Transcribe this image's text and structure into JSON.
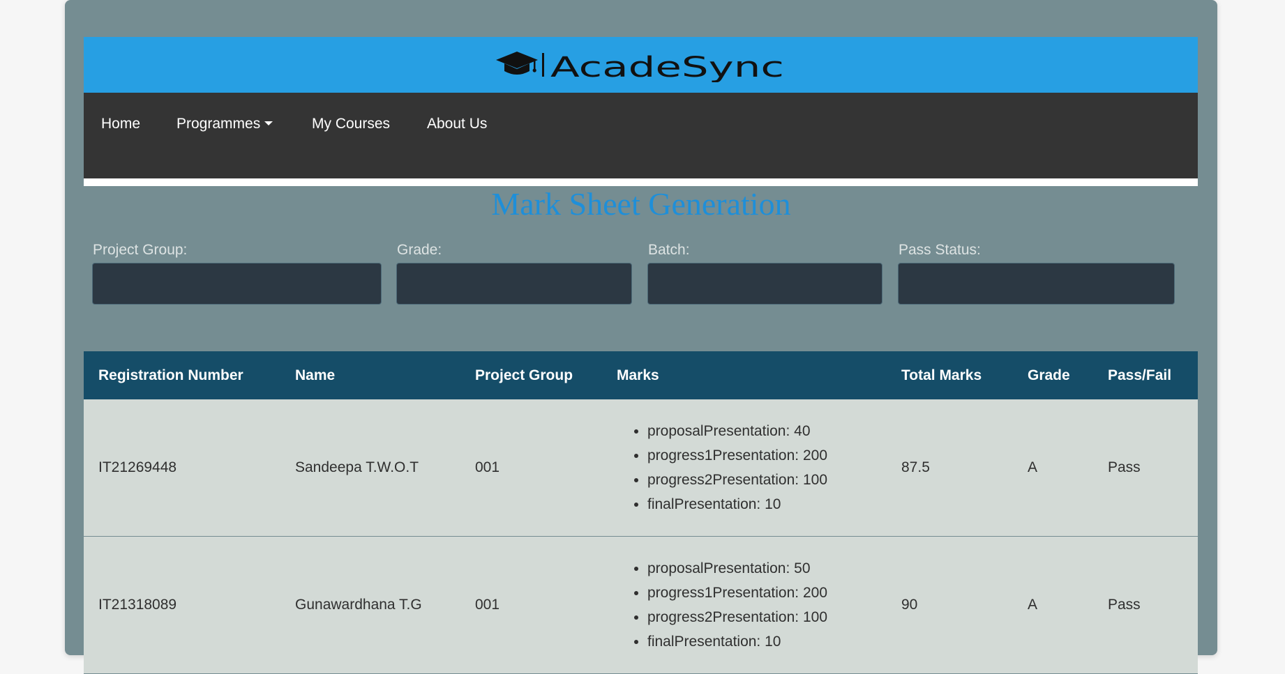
{
  "brand": {
    "name": "AcadeSync"
  },
  "nav": {
    "home": "Home",
    "programmes": "Programmes",
    "my_courses": "My Courses",
    "about_us": "About Us"
  },
  "page": {
    "title": "Mark Sheet Generation"
  },
  "filters": {
    "project_group": {
      "label": "Project Group:",
      "value": ""
    },
    "grade": {
      "label": "Grade:",
      "value": ""
    },
    "batch": {
      "label": "Batch:",
      "value": ""
    },
    "pass_status": {
      "label": "Pass Status:",
      "value": ""
    }
  },
  "table": {
    "headers": {
      "reg": "Registration Number",
      "name": "Name",
      "group": "Project Group",
      "marks": "Marks",
      "total": "Total Marks",
      "grade": "Grade",
      "pass": "Pass/Fail"
    },
    "rows": [
      {
        "reg": "IT21269448",
        "name": "Sandeepa T.W.O.T",
        "group": "001",
        "marks": [
          "proposalPresentation: 40",
          "progress1Presentation: 200",
          "progress2Presentation: 100",
          "finalPresentation: 10"
        ],
        "total": "87.5",
        "grade": "A",
        "pass": "Pass"
      },
      {
        "reg": "IT21318089",
        "name": "Gunawardhana T.G",
        "group": "001",
        "marks": [
          "proposalPresentation: 50",
          "progress1Presentation: 200",
          "progress2Presentation: 100",
          "finalPresentation: 10"
        ],
        "total": "90",
        "grade": "A",
        "pass": "Pass"
      }
    ]
  },
  "colors": {
    "brand_bar": "#279fe3",
    "nav_bg": "#343434",
    "card_bg": "#758d92",
    "title": "#1e8fd9",
    "table_header": "#154d68",
    "row_bg": "#d3dad6"
  }
}
